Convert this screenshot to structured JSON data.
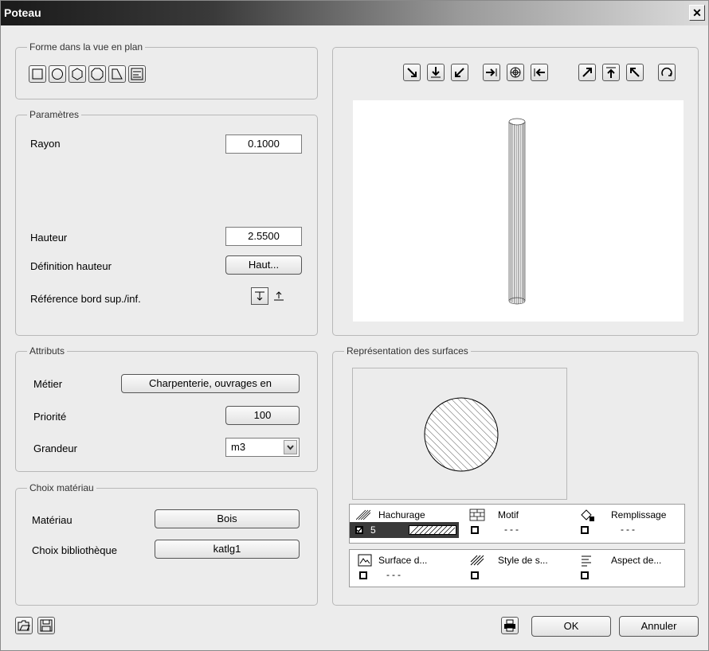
{
  "window": {
    "title": "Poteau"
  },
  "shape": {
    "legend": "Forme dans la vue en plan",
    "buttons": [
      "square-shape-icon",
      "circle-shape-icon",
      "hexagon-shape-icon",
      "polygon-shape-icon",
      "trapezoid-shape-icon",
      "profile-shape-icon"
    ]
  },
  "params": {
    "legend": "Paramètres",
    "rayon_label": "Rayon",
    "rayon_value": "0.1000",
    "hauteur_label": "Hauteur",
    "hauteur_value": "2.5500",
    "def_hauteur_label": "Définition hauteur",
    "def_hauteur_button": "Haut...",
    "reference_label": "Référence bord sup./inf."
  },
  "attributes": {
    "legend": "Attributs",
    "metier_label": "Métier",
    "metier_value": "Charpenterie, ouvrages en",
    "priorite_label": "Priorité",
    "priorite_value": "100",
    "grandeur_label": "Grandeur",
    "grandeur_value": "m3"
  },
  "material": {
    "legend": "Choix matériau",
    "materiau_label": "Matériau",
    "materiau_value": "Bois",
    "biblio_label": "Choix bibliothèque",
    "biblio_value": "katlg1"
  },
  "surfaces": {
    "legend": "Représentation des surfaces",
    "row1": {
      "hachurage": "Hachurage",
      "motif": "Motif",
      "remplissage": "Remplissage",
      "hatch_num": "5",
      "motif_val": "---",
      "rempl_val": "---"
    },
    "row2": {
      "surface": "Surface d...",
      "style": "Style de s...",
      "aspect": "Aspect de...",
      "surface_val": "---"
    }
  },
  "footer": {
    "ok": "OK",
    "cancel": "Annuler"
  }
}
